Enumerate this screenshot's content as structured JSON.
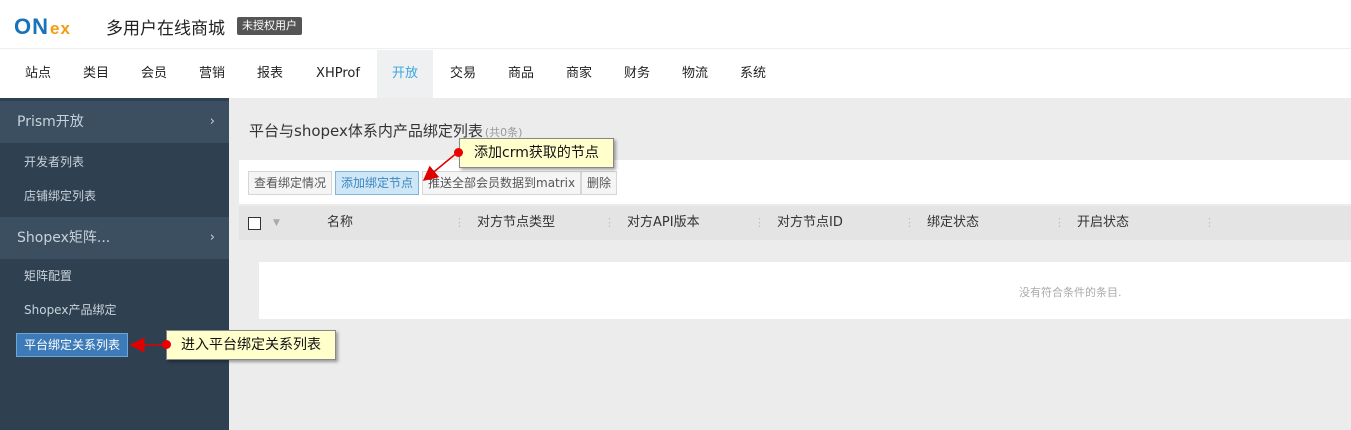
{
  "header": {
    "logo_on": "ON",
    "logo_ex": "ex",
    "site_title": "多用户在线商城",
    "unauth_badge": "未授权用户"
  },
  "nav": {
    "items": [
      "站点",
      "类目",
      "会员",
      "营销",
      "报表",
      "XHProf",
      "开放",
      "交易",
      "商品",
      "商家",
      "财务",
      "物流",
      "系统"
    ],
    "active": "开放"
  },
  "sidebar": {
    "groups": [
      {
        "label": "Prism开放",
        "links": [
          "开发者列表",
          "店铺绑定列表"
        ]
      },
      {
        "label": "Shopex矩阵...",
        "links": [
          "矩阵配置",
          "Shopex产品绑定",
          "平台绑定关系列表"
        ]
      }
    ],
    "active_link": "平台绑定关系列表",
    "chevron": "›"
  },
  "main": {
    "title": "平台与shopex体系内产品绑定列表",
    "count": "(共0条)",
    "toolbar": [
      "查看绑定情况",
      "添加绑定节点",
      "推送全部会员数据到matrix",
      "删除"
    ],
    "columns": [
      "名称",
      "对方节点类型",
      "对方API版本",
      "对方节点ID",
      "绑定状态",
      "开启状态"
    ],
    "empty_text": "没有符合条件的条目."
  },
  "callouts": {
    "add_node": "添加crm获取的节点",
    "enter_list": "进入平台绑定关系列表"
  },
  "colors": {
    "sidebar_bg": "#2f4050",
    "active_nav": "#3aa6e0",
    "callout_bg": "#ffffcc",
    "arrow": "#e00000"
  }
}
